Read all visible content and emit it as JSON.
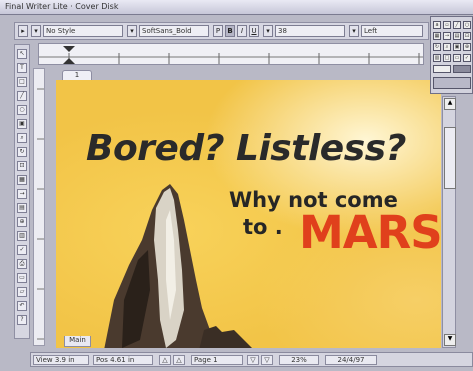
{
  "window": {
    "title": "Final Writer Lite  ·  Cover Disk"
  },
  "toolbar": {
    "style_select": "No Style",
    "font_select": "SoftSans_Bold",
    "plain_button": "P",
    "bold_button": "B",
    "italic_button": "I",
    "underline_button": "U",
    "size_select": "38",
    "align_select": "Left"
  },
  "document": {
    "page_tab": "1",
    "headline": "Bored? Listless?",
    "tagline_line1": "Why not come",
    "tagline_line2": "to .",
    "highlight": "MARS",
    "section_tab": "Main"
  },
  "statusbar": {
    "view": "View  3.9 in",
    "position": "Pos  4.61 in",
    "page": "Page  1",
    "zoom": "23%",
    "date": "24/4/97"
  }
}
